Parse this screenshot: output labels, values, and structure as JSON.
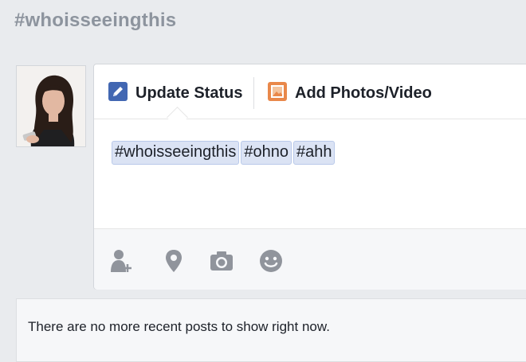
{
  "page": {
    "title": "#whoisseeingthis"
  },
  "composer": {
    "tabs": [
      {
        "label": "Update Status",
        "icon": "pencil-icon"
      },
      {
        "label": "Add Photos/Video",
        "icon": "photo-icon"
      }
    ],
    "hashtags": [
      "#whoisseeingthis",
      "#ohno",
      "#ahh"
    ],
    "actions": [
      "tag-people-icon",
      "location-pin-icon",
      "camera-icon",
      "emoji-icon"
    ]
  },
  "feed": {
    "empty_message": "There are no more recent posts to show right now."
  },
  "colors": {
    "accent": "#4267b2",
    "photo_orange": "#e9884a",
    "icon_gray": "#90949c"
  }
}
